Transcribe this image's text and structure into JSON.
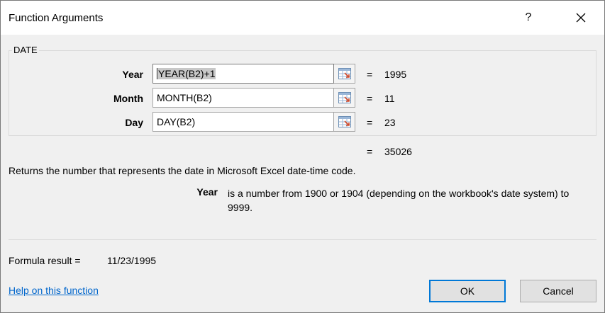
{
  "window": {
    "title": "Function Arguments",
    "help_glyph": "?",
    "close_icon": "close-icon"
  },
  "function": {
    "name": "DATE",
    "args": [
      {
        "label": "Year",
        "input": "YEAR(B2)+1",
        "value": "1995",
        "equals": "="
      },
      {
        "label": "Month",
        "input": "MONTH(B2)",
        "value": "11",
        "equals": "="
      },
      {
        "label": "Day",
        "input": "DAY(B2)",
        "value": "23",
        "equals": "="
      }
    ],
    "result_equals": "=",
    "result_value": "35026",
    "description": "Returns the number that represents the date in Microsoft Excel date-time code.",
    "arg_desc_name": "Year",
    "arg_desc_text": "is a number from 1900 or 1904 (depending on the workbook's date system) to 9999."
  },
  "footer": {
    "formula_label": "Formula result =",
    "formula_value": "11/23/1995",
    "help_link": "Help on this function",
    "ok_label": "OK",
    "cancel_label": "Cancel"
  },
  "colors": {
    "dialog_bg": "#f0f0f0",
    "titlebar_bg": "#ffffff",
    "link": "#0066cc",
    "ok_border": "#0078d7"
  }
}
